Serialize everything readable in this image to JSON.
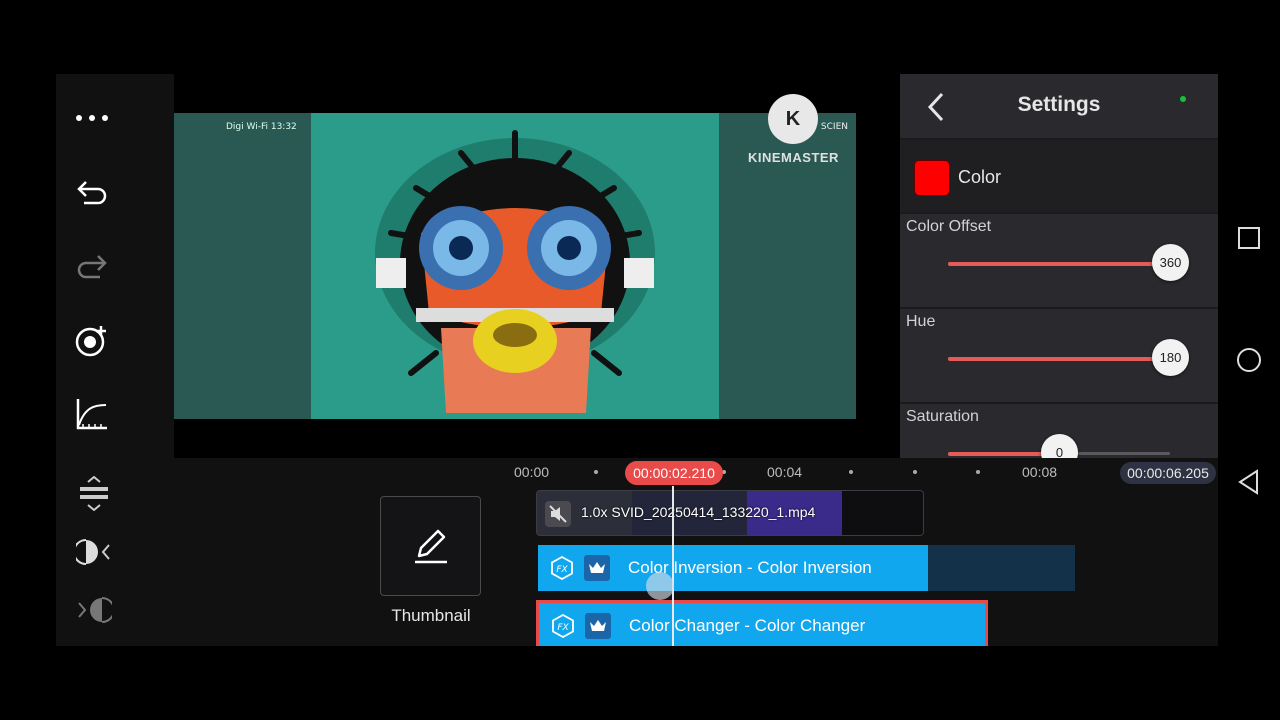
{
  "left_toolbar": {
    "icons": [
      "more-icon",
      "undo-icon",
      "redo-icon",
      "capture-icon",
      "curve-icon"
    ]
  },
  "preview": {
    "wifi_text": "Digi Wi-Fi 13:32",
    "corner_text": "SCIEN",
    "logo_letter": "K",
    "logo_text": "KINEMASTER",
    "colors": {
      "left_side": "#2a5954",
      "center": "#2b9c8a"
    }
  },
  "settings": {
    "title": "Settings",
    "color_label": "Color",
    "color_value": "#ff0000",
    "sliders": [
      {
        "label": "Color Offset",
        "value": "360",
        "fraction": 1.0
      },
      {
        "label": "Hue",
        "value": "180",
        "fraction": 1.0
      },
      {
        "label": "Saturation",
        "value": "0",
        "fraction": 0.5
      }
    ]
  },
  "timeline": {
    "start_time": "00:00",
    "playhead_time": "00:00:02.210",
    "mark_4": "00:04",
    "mark_8": "00:08",
    "end_time": "00:00:06.205",
    "thumbnail_label": "Thumbnail",
    "video_clip": {
      "name": "1.0x SVID_20250414_133220_1.mp4"
    },
    "effects": [
      {
        "name": "Color Inversion - Color Inversion",
        "selected": false
      },
      {
        "name": "Color Changer - Color Changer",
        "selected": true
      }
    ]
  },
  "nav_bar": {
    "icons": [
      "recents-icon",
      "home-icon",
      "back-icon"
    ]
  },
  "colors": {
    "accent": "#e94b4b",
    "effect_clip": "#11a7ee",
    "panel_bg": "#2a2a2e"
  }
}
